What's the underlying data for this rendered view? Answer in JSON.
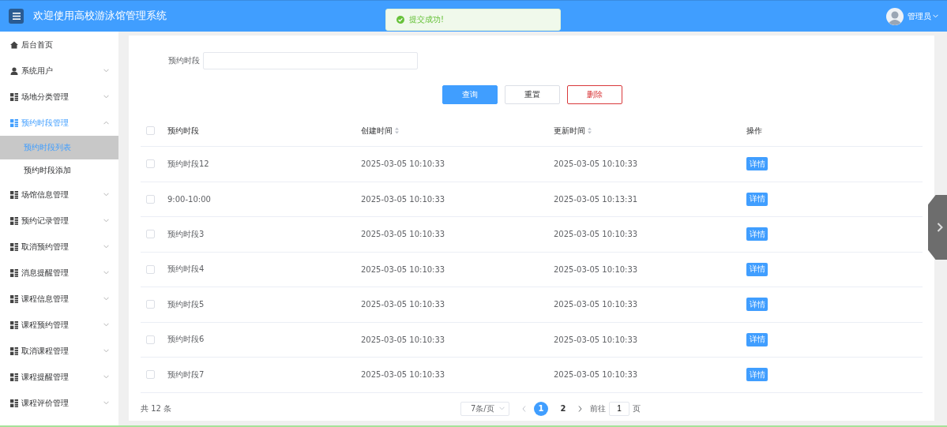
{
  "header": {
    "title": "欢迎使用高校游泳馆管理系统",
    "user": "管理员"
  },
  "toast": {
    "text": "提交成功!"
  },
  "sidebar": {
    "items": [
      {
        "label": "后台首页",
        "kind": "home",
        "expanded": false
      },
      {
        "label": "系统用户",
        "kind": "user",
        "expanded": false
      },
      {
        "label": "场地分类管理",
        "kind": "grid",
        "expanded": false
      },
      {
        "label": "预约时段管理",
        "kind": "grid",
        "expanded": true,
        "children": [
          {
            "label": "预约时段列表",
            "selected": true
          },
          {
            "label": "预约时段添加",
            "selected": false
          }
        ]
      },
      {
        "label": "场馆信息管理",
        "kind": "grid",
        "expanded": false
      },
      {
        "label": "预约记录管理",
        "kind": "grid",
        "expanded": false
      },
      {
        "label": "取消预约管理",
        "kind": "grid",
        "expanded": false
      },
      {
        "label": "消息提醒管理",
        "kind": "grid",
        "expanded": false
      },
      {
        "label": "课程信息管理",
        "kind": "grid",
        "expanded": false
      },
      {
        "label": "课程预约管理",
        "kind": "grid",
        "expanded": false
      },
      {
        "label": "取消课程管理",
        "kind": "grid",
        "expanded": false
      },
      {
        "label": "课程提醒管理",
        "kind": "grid",
        "expanded": false
      },
      {
        "label": "课程评价管理",
        "kind": "grid",
        "expanded": false
      }
    ]
  },
  "search": {
    "label": "预约时段"
  },
  "buttons": [
    {
      "label": "查询",
      "kind": "primary"
    },
    {
      "label": "重置",
      "kind": "default"
    },
    {
      "label": "删除",
      "kind": "danger"
    }
  ],
  "table": {
    "select_all_checked": false,
    "columns": [
      {
        "label": "预约时段",
        "kind": "plain"
      },
      {
        "label": "创建时间",
        "kind": "sortable"
      },
      {
        "label": "更新时间",
        "kind": "sortable"
      },
      {
        "label": "操作",
        "kind": "plain"
      }
    ],
    "rows": [
      {
        "slot": "预约时段12",
        "created": "2025-03-05 10:10:33",
        "updated": "2025-03-05 10:10:33",
        "action": "详情",
        "checked": false
      },
      {
        "slot": "9:00-10:00",
        "created": "2025-03-05 10:10:33",
        "updated": "2025-03-05 10:13:31",
        "action": "详情",
        "checked": false
      },
      {
        "slot": "预约时段3",
        "created": "2025-03-05 10:10:33",
        "updated": "2025-03-05 10:10:33",
        "action": "详情",
        "checked": false
      },
      {
        "slot": "预约时段4",
        "created": "2025-03-05 10:10:33",
        "updated": "2025-03-05 10:10:33",
        "action": "详情",
        "checked": false
      },
      {
        "slot": "预约时段5",
        "created": "2025-03-05 10:10:33",
        "updated": "2025-03-05 10:10:33",
        "action": "详情",
        "checked": false
      },
      {
        "slot": "预约时段6",
        "created": "2025-03-05 10:10:33",
        "updated": "2025-03-05 10:10:33",
        "action": "详情",
        "checked": false
      },
      {
        "slot": "预约时段7",
        "created": "2025-03-05 10:10:33",
        "updated": "2025-03-05 10:10:33",
        "action": "详情",
        "checked": false
      }
    ]
  },
  "pagination": {
    "total": "共 12 条",
    "page_size": "7条/页",
    "pages": [
      {
        "label": "1",
        "selected": true
      },
      {
        "label": "2",
        "selected": false
      }
    ],
    "goto_label": "前往",
    "goto_value": "1",
    "goto_suffix": "页"
  }
}
